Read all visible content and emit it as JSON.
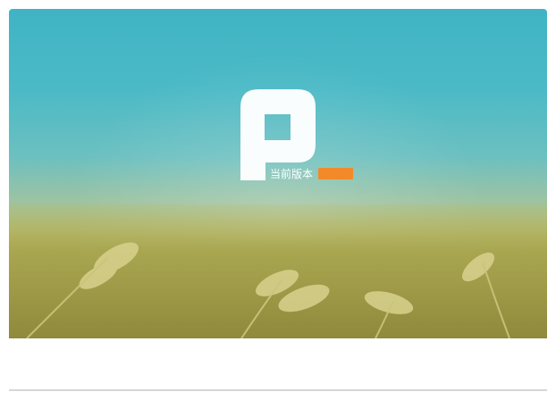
{
  "app": {
    "version_label": "当前版本",
    "version_value": ""
  },
  "colors": {
    "sky_top": "#3fb4c4",
    "wheat": "#b8bd74",
    "badge_orange": "#f28a2a",
    "logo_white": "#ffffff"
  },
  "icons": {
    "logo": "p-logo-icon"
  }
}
